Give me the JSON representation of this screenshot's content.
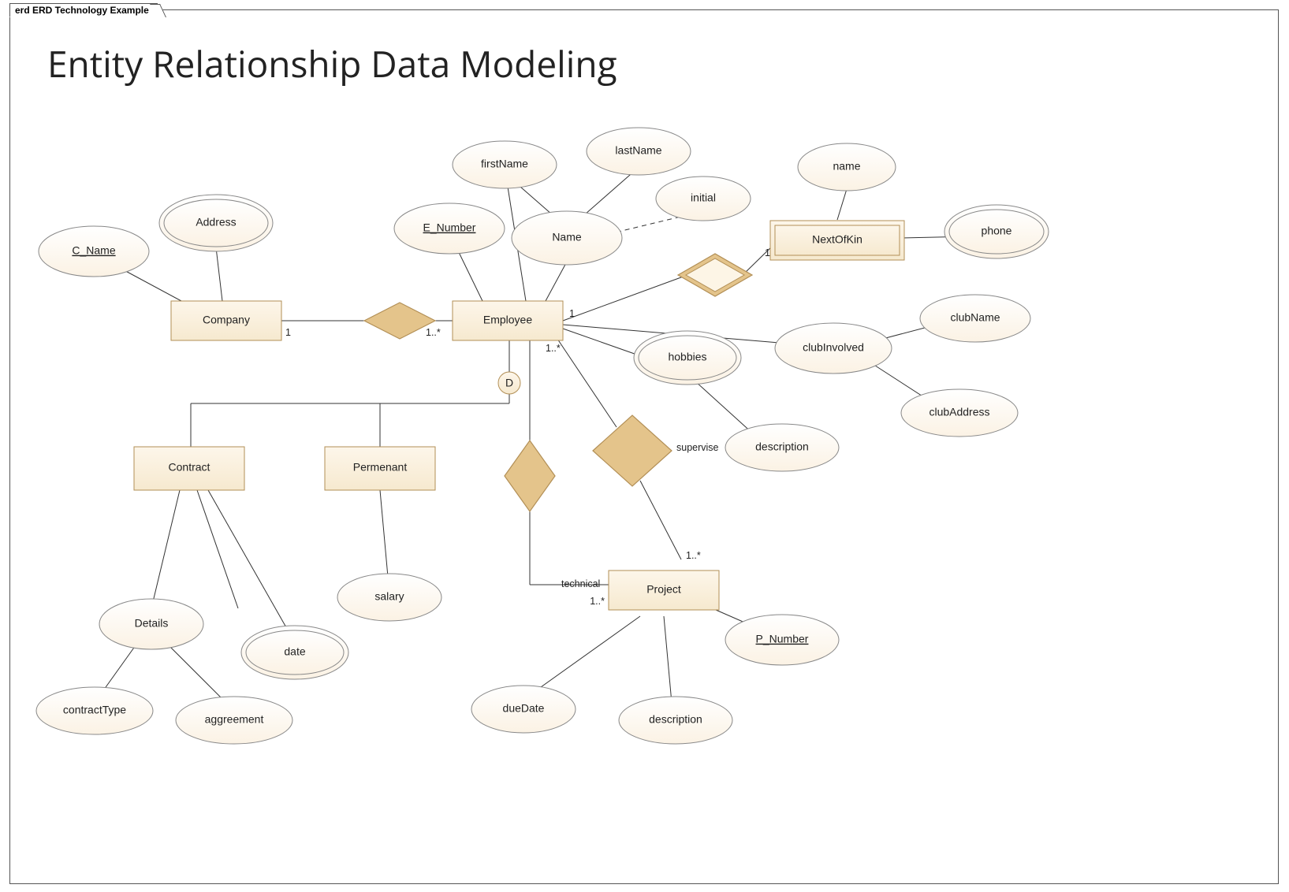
{
  "tab_title": "erd ERD Technology Example",
  "diagram_title": "Entity Relationship Data Modeling",
  "entities": {
    "company": "Company",
    "employee": "Employee",
    "nextofkin": "NextOfKin",
    "contract": "Contract",
    "permanent": "Permenant",
    "project": "Project"
  },
  "attributes": {
    "c_name": "C_Name",
    "address": "Address",
    "e_number": "E_Number",
    "firstname": "firstName",
    "lastname": "lastName",
    "initial": "initial",
    "name": "Name",
    "nok_name": "name",
    "phone": "phone",
    "hobbies": "hobbies",
    "clubinvolved": "clubInvolved",
    "clubname": "clubName",
    "clubaddress": "clubAddress",
    "nok_description": "description",
    "details": "Details",
    "contracttype": "contractType",
    "date": "date",
    "aggreement": "aggreement",
    "salary": "salary",
    "duedate": "dueDate",
    "proj_description": "description",
    "p_number": "P_Number"
  },
  "relationships": {
    "supervise": "supervise",
    "technical": "technical"
  },
  "cardinalities": {
    "company_side": "1",
    "employee_company_side": "1..*",
    "employee_nok_side": "1",
    "nok_side": "1",
    "employee_project_side": "1..*",
    "project_supervise_side": "1..*",
    "project_technical_side": "1..*"
  },
  "disjoint_label": "D"
}
